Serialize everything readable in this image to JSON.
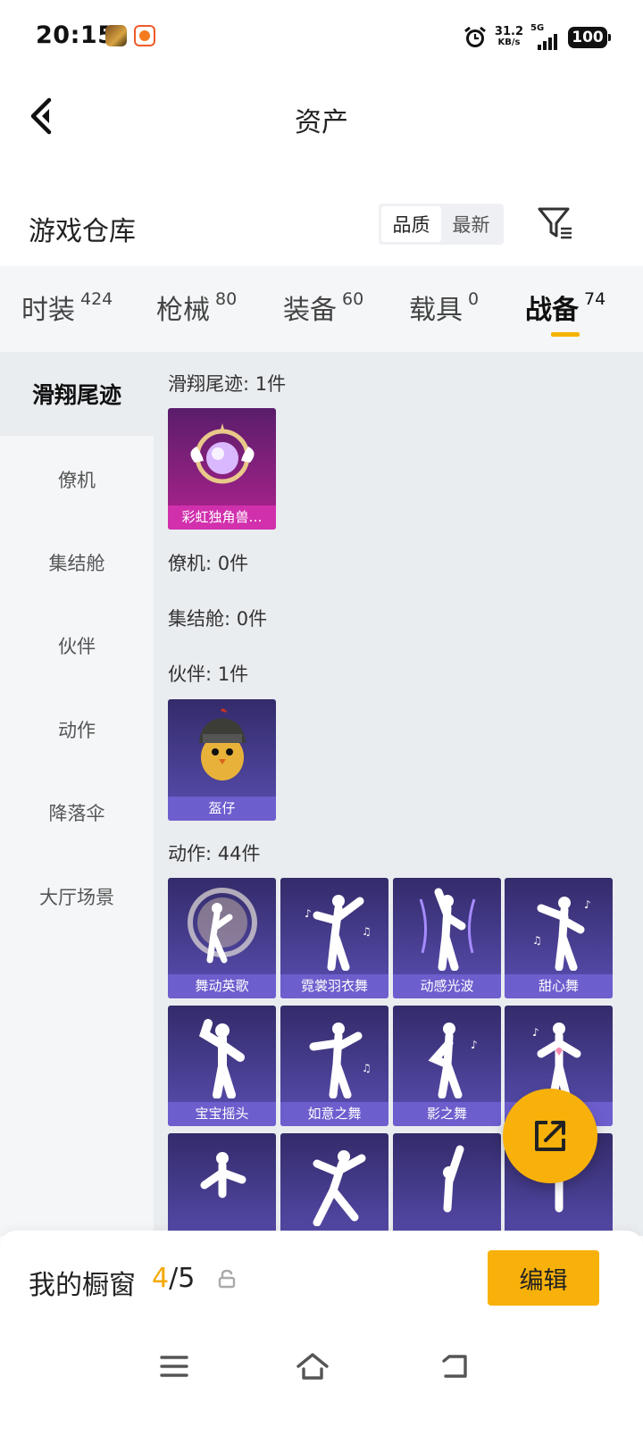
{
  "status": {
    "time": "20:15",
    "speed_value": "31.2",
    "speed_unit": "KB/s",
    "network": "5G",
    "battery": "100"
  },
  "nav": {
    "title": "资产",
    "back_icon": "chevron-left-icon"
  },
  "section": {
    "title": "游戏仓库",
    "sort_options": [
      "品质",
      "最新"
    ],
    "sort_selected": "品质",
    "filter_icon": "filter-icon"
  },
  "tabs": [
    {
      "label": "时装",
      "count": "424"
    },
    {
      "label": "枪械",
      "count": "80"
    },
    {
      "label": "装备",
      "count": "60"
    },
    {
      "label": "载具",
      "count": "0"
    },
    {
      "label": "战备",
      "count": "74",
      "active": true
    }
  ],
  "sidebar": {
    "items": [
      "滑翔尾迹",
      "僚机",
      "集结舱",
      "伙伴",
      "动作",
      "降落伞",
      "大厅场景"
    ],
    "active": "滑翔尾迹"
  },
  "content": {
    "groups": [
      {
        "label": "滑翔尾迹: 1件",
        "items": [
          "彩虹独角兽…"
        ]
      },
      {
        "label": "僚机: 0件",
        "items": []
      },
      {
        "label": "集结舱: 0件",
        "items": []
      },
      {
        "label": "伙伴: 1件",
        "items": [
          "盔仔"
        ]
      },
      {
        "label": "动作: 44件",
        "items": [
          "舞动英歌",
          "霓裳羽衣舞",
          "动感光波",
          "甜心舞",
          "宝宝摇头",
          "如意之舞",
          "影之舞",
          "",
          "",
          "",
          "",
          ""
        ]
      }
    ]
  },
  "showcase": {
    "label": "我的橱窗",
    "current": "4",
    "total": "/5",
    "edit_label": "编辑"
  },
  "colors": {
    "accent": "#f7b10a",
    "legend_card": "#b0238f",
    "epic_card": "#5a4fb2"
  }
}
